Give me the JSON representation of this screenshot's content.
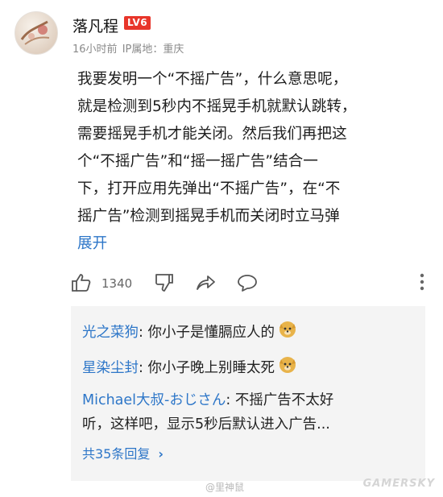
{
  "post": {
    "username": "落凡程",
    "level": "LV6",
    "time": "16小时前",
    "ip_label": "IP属地：重庆",
    "lines": [
      "我要发明一个“不摇广告”，什么意思呢，",
      "就是检测到5秒内不摇晃手机就默认跳转，",
      "需要摇晃手机才能关闭。然后我们再把这",
      "个“不摇广告”和“摇一摇广告”结合一",
      "下，打开应用先弹出“不摇广告”，在“不",
      "摇广告”检测到摇晃手机而关闭时立马弹"
    ],
    "expand": "展开",
    "likes": "1340"
  },
  "replies": [
    {
      "name": "光之菜狗",
      "text": "你小子是懂膈应人的"
    },
    {
      "name": "星染尘封",
      "text": "你小子晚上别睡太死"
    },
    {
      "name": "Michael大叔-おじさん",
      "text": "不摇广告不太好",
      "text2": "听，这样吧，显示5秒后默认进入广告..."
    }
  ],
  "reply_more": "共35条回复",
  "watermark": "@里神鼠",
  "brand": "GAMERSKY",
  "colors": {
    "accent": "#2d76c8",
    "level_badge": "#e8352a",
    "reply_bg": "#f4f4f4"
  }
}
